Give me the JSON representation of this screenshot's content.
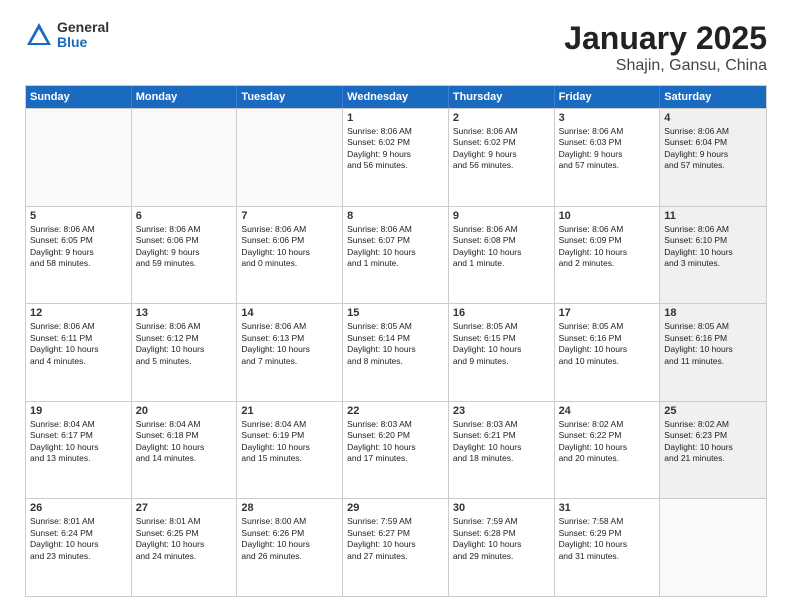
{
  "logo": {
    "general": "General",
    "blue": "Blue"
  },
  "title": "January 2025",
  "subtitle": "Shajin, Gansu, China",
  "header_days": [
    "Sunday",
    "Monday",
    "Tuesday",
    "Wednesday",
    "Thursday",
    "Friday",
    "Saturday"
  ],
  "weeks": [
    [
      {
        "day": "",
        "text": "",
        "empty": true
      },
      {
        "day": "",
        "text": "",
        "empty": true
      },
      {
        "day": "",
        "text": "",
        "empty": true
      },
      {
        "day": "1",
        "text": "Sunrise: 8:06 AM\nSunset: 6:02 PM\nDaylight: 9 hours\nand 56 minutes.",
        "empty": false
      },
      {
        "day": "2",
        "text": "Sunrise: 8:06 AM\nSunset: 6:02 PM\nDaylight: 9 hours\nand 56 minutes.",
        "empty": false
      },
      {
        "day": "3",
        "text": "Sunrise: 8:06 AM\nSunset: 6:03 PM\nDaylight: 9 hours\nand 57 minutes.",
        "empty": false
      },
      {
        "day": "4",
        "text": "Sunrise: 8:06 AM\nSunset: 6:04 PM\nDaylight: 9 hours\nand 57 minutes.",
        "empty": false,
        "shaded": true
      }
    ],
    [
      {
        "day": "5",
        "text": "Sunrise: 8:06 AM\nSunset: 6:05 PM\nDaylight: 9 hours\nand 58 minutes.",
        "empty": false
      },
      {
        "day": "6",
        "text": "Sunrise: 8:06 AM\nSunset: 6:06 PM\nDaylight: 9 hours\nand 59 minutes.",
        "empty": false
      },
      {
        "day": "7",
        "text": "Sunrise: 8:06 AM\nSunset: 6:06 PM\nDaylight: 10 hours\nand 0 minutes.",
        "empty": false
      },
      {
        "day": "8",
        "text": "Sunrise: 8:06 AM\nSunset: 6:07 PM\nDaylight: 10 hours\nand 1 minute.",
        "empty": false
      },
      {
        "day": "9",
        "text": "Sunrise: 8:06 AM\nSunset: 6:08 PM\nDaylight: 10 hours\nand 1 minute.",
        "empty": false
      },
      {
        "day": "10",
        "text": "Sunrise: 8:06 AM\nSunset: 6:09 PM\nDaylight: 10 hours\nand 2 minutes.",
        "empty": false
      },
      {
        "day": "11",
        "text": "Sunrise: 8:06 AM\nSunset: 6:10 PM\nDaylight: 10 hours\nand 3 minutes.",
        "empty": false,
        "shaded": true
      }
    ],
    [
      {
        "day": "12",
        "text": "Sunrise: 8:06 AM\nSunset: 6:11 PM\nDaylight: 10 hours\nand 4 minutes.",
        "empty": false
      },
      {
        "day": "13",
        "text": "Sunrise: 8:06 AM\nSunset: 6:12 PM\nDaylight: 10 hours\nand 5 minutes.",
        "empty": false
      },
      {
        "day": "14",
        "text": "Sunrise: 8:06 AM\nSunset: 6:13 PM\nDaylight: 10 hours\nand 7 minutes.",
        "empty": false
      },
      {
        "day": "15",
        "text": "Sunrise: 8:05 AM\nSunset: 6:14 PM\nDaylight: 10 hours\nand 8 minutes.",
        "empty": false
      },
      {
        "day": "16",
        "text": "Sunrise: 8:05 AM\nSunset: 6:15 PM\nDaylight: 10 hours\nand 9 minutes.",
        "empty": false
      },
      {
        "day": "17",
        "text": "Sunrise: 8:05 AM\nSunset: 6:16 PM\nDaylight: 10 hours\nand 10 minutes.",
        "empty": false
      },
      {
        "day": "18",
        "text": "Sunrise: 8:05 AM\nSunset: 6:16 PM\nDaylight: 10 hours\nand 11 minutes.",
        "empty": false,
        "shaded": true
      }
    ],
    [
      {
        "day": "19",
        "text": "Sunrise: 8:04 AM\nSunset: 6:17 PM\nDaylight: 10 hours\nand 13 minutes.",
        "empty": false
      },
      {
        "day": "20",
        "text": "Sunrise: 8:04 AM\nSunset: 6:18 PM\nDaylight: 10 hours\nand 14 minutes.",
        "empty": false
      },
      {
        "day": "21",
        "text": "Sunrise: 8:04 AM\nSunset: 6:19 PM\nDaylight: 10 hours\nand 15 minutes.",
        "empty": false
      },
      {
        "day": "22",
        "text": "Sunrise: 8:03 AM\nSunset: 6:20 PM\nDaylight: 10 hours\nand 17 minutes.",
        "empty": false
      },
      {
        "day": "23",
        "text": "Sunrise: 8:03 AM\nSunset: 6:21 PM\nDaylight: 10 hours\nand 18 minutes.",
        "empty": false
      },
      {
        "day": "24",
        "text": "Sunrise: 8:02 AM\nSunset: 6:22 PM\nDaylight: 10 hours\nand 20 minutes.",
        "empty": false
      },
      {
        "day": "25",
        "text": "Sunrise: 8:02 AM\nSunset: 6:23 PM\nDaylight: 10 hours\nand 21 minutes.",
        "empty": false,
        "shaded": true
      }
    ],
    [
      {
        "day": "26",
        "text": "Sunrise: 8:01 AM\nSunset: 6:24 PM\nDaylight: 10 hours\nand 23 minutes.",
        "empty": false
      },
      {
        "day": "27",
        "text": "Sunrise: 8:01 AM\nSunset: 6:25 PM\nDaylight: 10 hours\nand 24 minutes.",
        "empty": false
      },
      {
        "day": "28",
        "text": "Sunrise: 8:00 AM\nSunset: 6:26 PM\nDaylight: 10 hours\nand 26 minutes.",
        "empty": false
      },
      {
        "day": "29",
        "text": "Sunrise: 7:59 AM\nSunset: 6:27 PM\nDaylight: 10 hours\nand 27 minutes.",
        "empty": false
      },
      {
        "day": "30",
        "text": "Sunrise: 7:59 AM\nSunset: 6:28 PM\nDaylight: 10 hours\nand 29 minutes.",
        "empty": false
      },
      {
        "day": "31",
        "text": "Sunrise: 7:58 AM\nSunset: 6:29 PM\nDaylight: 10 hours\nand 31 minutes.",
        "empty": false
      },
      {
        "day": "",
        "text": "",
        "empty": true,
        "shaded": true
      }
    ]
  ]
}
